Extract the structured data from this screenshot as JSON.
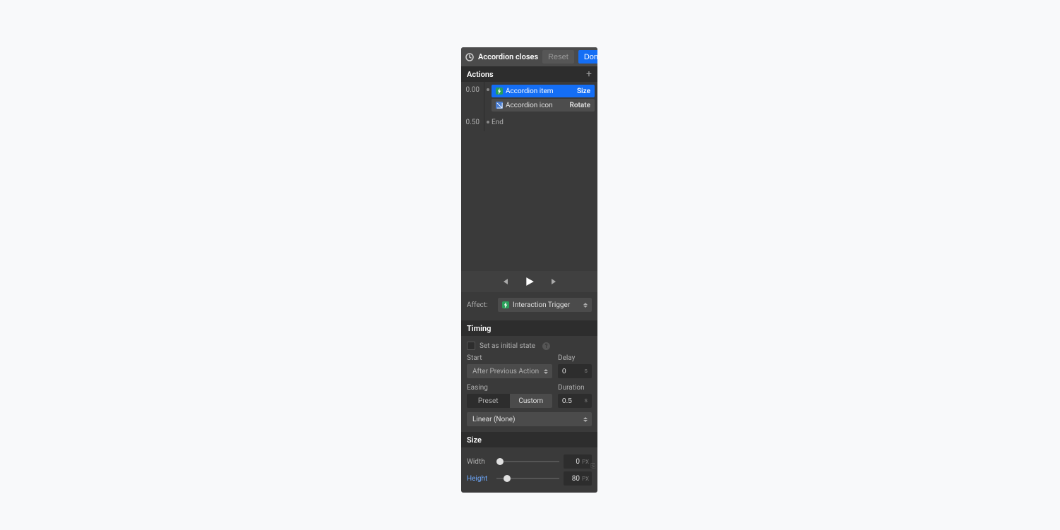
{
  "header": {
    "title": "Accordion closes",
    "reset_label": "Reset",
    "done_label": "Done"
  },
  "actions": {
    "section_label": "Actions",
    "rows": [
      {
        "time": "0.00",
        "items": [
          {
            "name": "Accordion item",
            "action": "Size",
            "sel": true
          },
          {
            "name": "Accordion icon",
            "action": "Rotate",
            "sel": false
          }
        ]
      },
      {
        "time": "0.50",
        "end_label": "End"
      }
    ]
  },
  "affect": {
    "label": "Affect:",
    "value": "Interaction Trigger"
  },
  "timing": {
    "section_label": "Timing",
    "initial_state_label": "Set as initial state",
    "start_label": "Start",
    "start_value": "After Previous Action",
    "delay_label": "Delay",
    "delay_value": "0",
    "delay_unit": "s",
    "easing_label": "Easing",
    "easing_preset": "Preset",
    "easing_custom": "Custom",
    "easing_value": "Linear (None)",
    "duration_label": "Duration",
    "duration_value": "0.5",
    "duration_unit": "s"
  },
  "size": {
    "section_label": "Size",
    "width_label": "Width",
    "width_value": "0",
    "width_unit": "PX",
    "height_label": "Height",
    "height_value": "80",
    "height_unit": "PX"
  }
}
